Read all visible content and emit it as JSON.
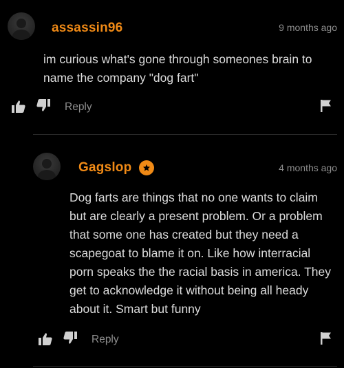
{
  "comments": [
    {
      "username": "assassin96",
      "time": "9 months ago",
      "text": "im curious what's gone through someones brain to name the company \"dog fart\"",
      "reply_label": "Reply",
      "has_badge": false
    },
    {
      "username": "Gagslop",
      "time": "4 months ago",
      "text": "Dog farts are things that no one wants to claim but are clearly a present problem. Or a problem that some one has created but they need a scapegoat to blame it on. Like how interracial porn speaks the the racial basis in america. They get to acknowledge it without being all heady about it. Smart but funny",
      "reply_label": "Reply",
      "has_badge": true
    }
  ],
  "icons": {
    "like": "thumbs-up-icon",
    "dislike": "thumbs-down-icon",
    "flag": "flag-icon",
    "badge": "star-badge-icon",
    "avatar": "default-avatar-icon"
  },
  "colors": {
    "accent": "#f08a16",
    "background": "#000000",
    "text": "#dcdcdc",
    "muted": "#8e8e8e"
  }
}
